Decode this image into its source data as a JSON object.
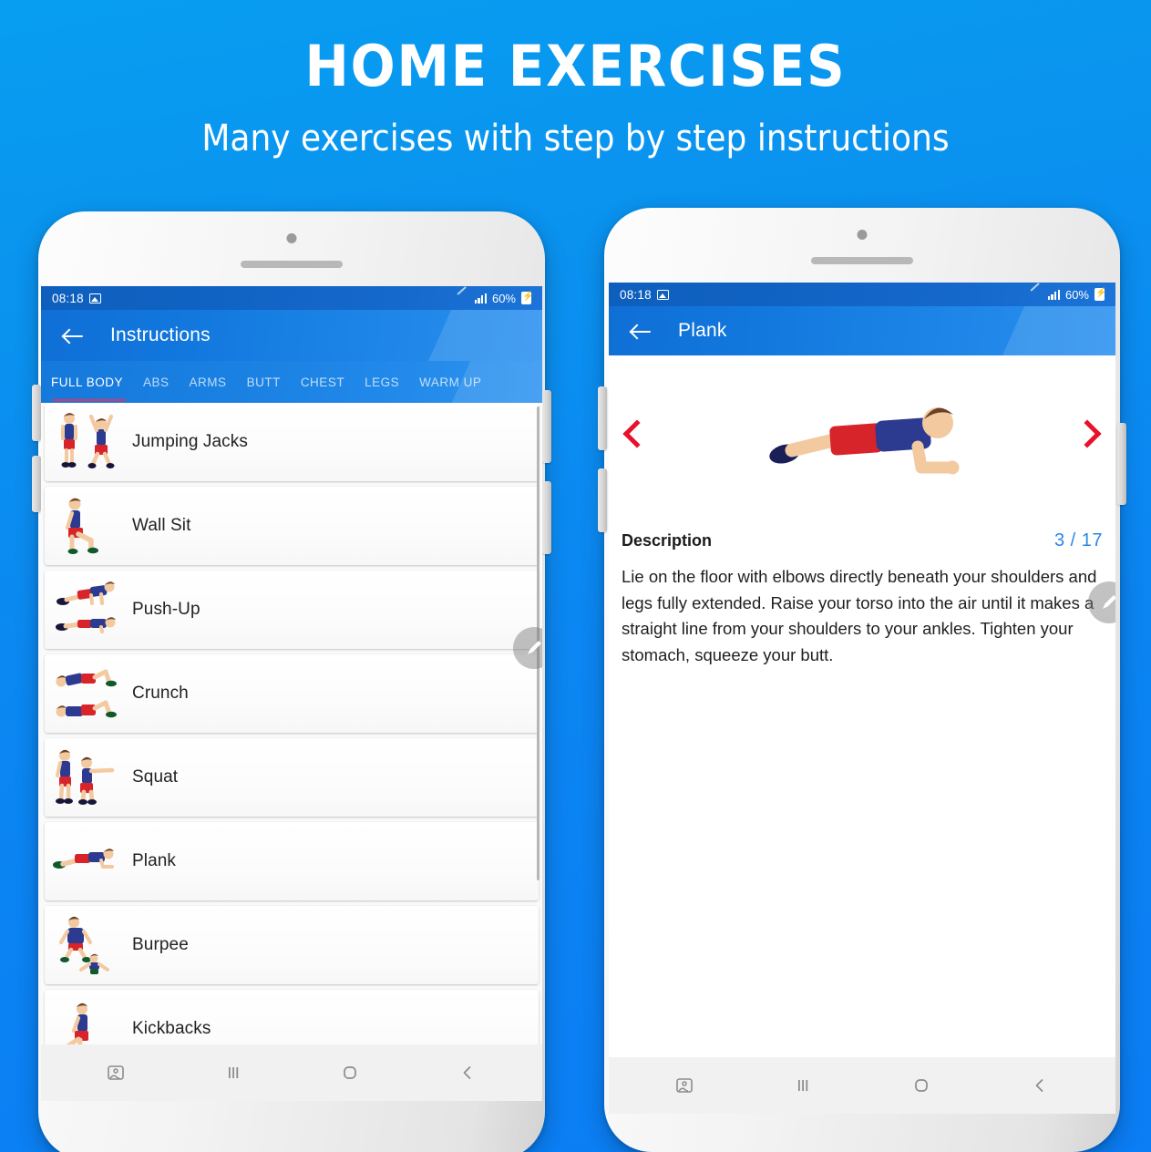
{
  "promo": {
    "title": "HOME  EXERCISES",
    "subtitle": "Many exercises with step by step instructions",
    "background_color": "#0b8cf0"
  },
  "left_phone": {
    "status_bar": {
      "time": "08:18",
      "photo_icon": "photo-icon",
      "pen_icon": "pen-icon",
      "signal_icon": "signal-icon",
      "battery_percent": "60%",
      "battery_icon": "battery-charging-icon"
    },
    "app_bar": {
      "back_icon": "back-arrow-icon",
      "title": "Instructions",
      "accent_color": "#1278de"
    },
    "tabs": {
      "active_index": 0,
      "indicator_color": "#e0345c",
      "items": [
        {
          "label": "FULL BODY"
        },
        {
          "label": "ABS"
        },
        {
          "label": "ARMS"
        },
        {
          "label": "BUTT"
        },
        {
          "label": "CHEST"
        },
        {
          "label": "LEGS"
        },
        {
          "label": "WARM UP"
        }
      ]
    },
    "exercises": [
      {
        "name": "Jumping Jacks",
        "icon": "jumping-jacks-thumb"
      },
      {
        "name": "Wall Sit",
        "icon": "wall-sit-thumb"
      },
      {
        "name": "Push-Up",
        "icon": "push-up-thumb"
      },
      {
        "name": "Crunch",
        "icon": "crunch-thumb"
      },
      {
        "name": "Squat",
        "icon": "squat-thumb"
      },
      {
        "name": "Plank",
        "icon": "plank-thumb"
      },
      {
        "name": "Burpee",
        "icon": "burpee-thumb"
      },
      {
        "name": "Kickbacks",
        "icon": "kickbacks-thumb"
      }
    ],
    "fab": {
      "icon": "pencil-icon"
    },
    "bottom_nav": [
      {
        "icon": "screenshot-icon"
      },
      {
        "icon": "recents-icon"
      },
      {
        "icon": "home-icon"
      },
      {
        "icon": "back-icon"
      }
    ]
  },
  "right_phone": {
    "status_bar": {
      "time": "08:18",
      "photo_icon": "photo-icon",
      "pen_icon": "pen-icon",
      "signal_icon": "signal-icon",
      "battery_percent": "60%",
      "battery_icon": "battery-charging-icon"
    },
    "app_bar": {
      "back_icon": "back-arrow-icon",
      "title": "Plank",
      "accent_color": "#1278de"
    },
    "carousel": {
      "prev_icon": "chevron-left-icon",
      "next_icon": "chevron-right-icon",
      "arrow_color": "#e8102a",
      "image": "plank-illustration"
    },
    "description": {
      "heading": "Description",
      "counter": "3 / 17",
      "counter_color": "#2a86e8",
      "body": "Lie on the floor with elbows directly beneath your shoulders and legs fully extended. Raise your torso into the air until it makes a straight line from your shoulders to your ankles. Tighten your stomach, squeeze your butt."
    },
    "fab": {
      "icon": "pencil-icon"
    },
    "bottom_nav": [
      {
        "icon": "screenshot-icon"
      },
      {
        "icon": "recents-icon"
      },
      {
        "icon": "home-icon"
      },
      {
        "icon": "back-icon"
      }
    ]
  }
}
